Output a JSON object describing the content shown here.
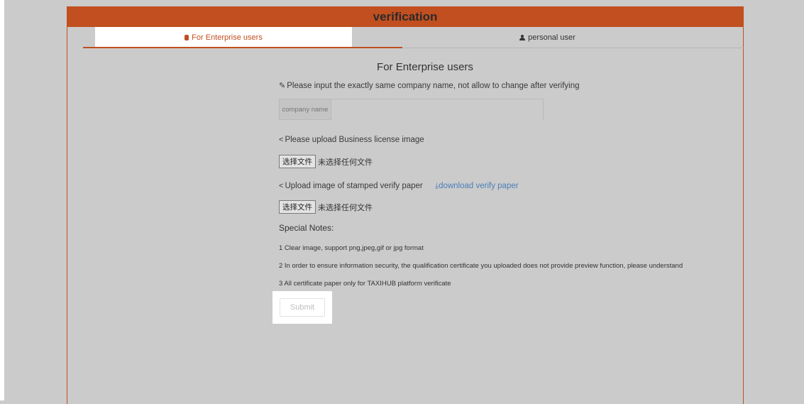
{
  "header": {
    "title": "verification"
  },
  "tabs": [
    {
      "label": "For Enterprise users",
      "icon": "database-icon",
      "active": true
    },
    {
      "label": "personal user",
      "icon": "user-icon",
      "active": false
    }
  ],
  "form": {
    "title": "For Enterprise users",
    "company_hint": "Please input the exactly same company name, not allow to change after verifying",
    "company_addon": "company name",
    "company_value": "",
    "license_label": "Please upload Business license image",
    "file_button": "选择文件",
    "no_file_text": "未选择任何文件",
    "stamped_label": "Upload image of stamped verify paper",
    "download_link": "download verify paper",
    "notes_title": "Special Notes:",
    "notes": [
      "1 Clear image, support png,jpeg,gif or jpg format",
      "2 In order to ensure information security, the qualification certificate you uploaded does not provide preview function, please understand",
      "3 All certificate paper only for TAXIHUB platform verificate"
    ],
    "submit_label": "Submit"
  },
  "colors": {
    "accent": "#c14f1f",
    "link": "#4a7fb8",
    "background": "#cbcbcb"
  }
}
